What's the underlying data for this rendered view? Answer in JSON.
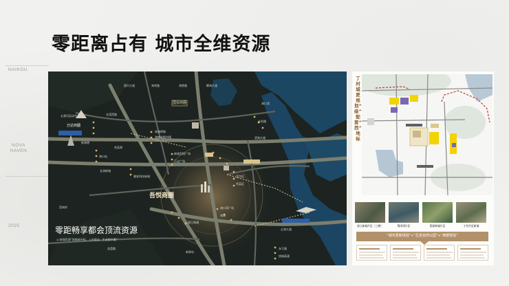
{
  "headline": "零距离占有  城市全维资源",
  "side_labels": [
    "NAIKOU",
    "NOVA HAVEN",
    "2025"
  ],
  "map": {
    "poster_title": "零距畅享都会顶流资源",
    "poster_subtitle": "◎ 新城资源“地铁新中枢，入市商业，生态都市圈”",
    "center_name": "吾悦商圈",
    "mall_name": "万达商圈",
    "district_badge": "国贸商圈",
    "place_labels": [
      "五源河运动中心",
      "长滨西路",
      "新海港",
      "秀英港",
      "海口站",
      "新城吾悦广场",
      "万达广场",
      "南海明珠",
      "海南省图书馆",
      "长流新城",
      "美安科技新城",
      "海口湾",
      "龙华区",
      "秀英区",
      "海口湾广场",
      "南港",
      "假日海滩",
      "丘海大道",
      "滨海大道",
      "长彤路",
      "永万路",
      "绕城高速",
      "国兴大道",
      "海秀路",
      "海垦路",
      "椰海大道",
      "金盘路",
      "西海岸",
      "新埠岛"
    ],
    "colors": {
      "bg": "#1c2320",
      "water": "#1c4763",
      "road": "#7c7f6e",
      "glow": "#c6a36a"
    }
  },
  "right_panel": {
    "vertical_text": "丁村城更规划“城级”全配套“城西”新地标",
    "thumbs": [
      "滨江新城片区（三期）",
      "锦鸿湾片区",
      "西部新城片区",
      "丁村片区新城"
    ],
    "banner": "“城市更新规划”+“生态自然公园”+“西部规划”",
    "colors": {
      "accent": "#b2916a",
      "yellow": "#f2d400",
      "purple": "#7a68b0",
      "red": "#c0392b"
    }
  }
}
